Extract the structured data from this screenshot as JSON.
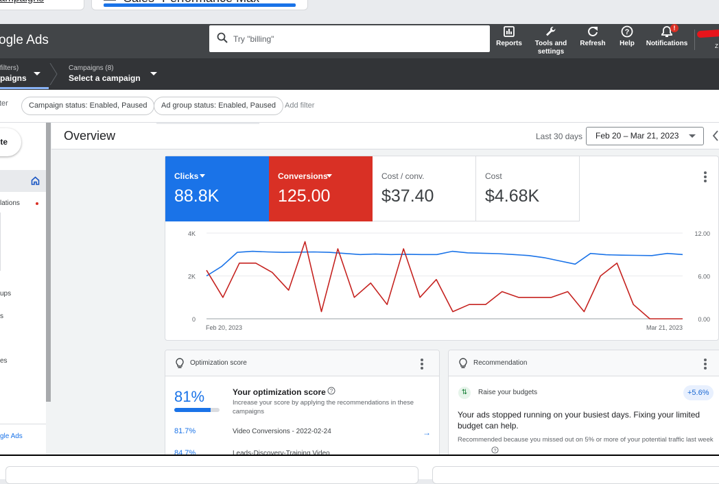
{
  "background_tabs": {
    "left_label": "ampaigns",
    "right_label": "Sales- Performance Max -"
  },
  "app": {
    "logo": "ogle Ads",
    "search_placeholder": "Try \"billing\"",
    "tools": [
      {
        "label": "Reports",
        "icon": "reports-icon"
      },
      {
        "label": "Tools and settings",
        "icon": "wrench-icon"
      },
      {
        "label": "Refresh",
        "icon": "refresh-icon"
      },
      {
        "label": "Help",
        "icon": "help-icon"
      },
      {
        "label": "Notifications",
        "icon": "bell-icon"
      }
    ],
    "notification_badge": "!",
    "avatar_initial": "Z"
  },
  "breadcrumb": {
    "first_small": "filters)",
    "first_big": "paigns",
    "second_small": "Campaigns (8)",
    "second_big": "Select a campaign"
  },
  "filters": {
    "prefix": "ter",
    "chips": [
      "Campaign status: Enabled, Paused",
      "Ad group status: Enabled, Paused"
    ],
    "add_filter": "Add filter"
  },
  "nav": {
    "create": "te",
    "items": [
      "lations",
      "ups",
      "s",
      "es"
    ],
    "footer": "gle Ads"
  },
  "overview": {
    "title": "Overview",
    "date_label": "Last 30 days",
    "date_range": "Feb 20 – Mar 21, 2023"
  },
  "metrics": [
    {
      "label": "Clicks",
      "value": "88.8K",
      "color": "#1a73e8"
    },
    {
      "label": "Conversions",
      "value": "125.00",
      "color": "#d93025"
    },
    {
      "label": "Cost / conv.",
      "value": "$37.40"
    },
    {
      "label": "Cost",
      "value": "$4.68K"
    }
  ],
  "chart_data": {
    "type": "line",
    "x_start_label": "Feb 20, 2023",
    "x_end_label": "Mar 21, 2023",
    "y_left_ticks": [
      "4K",
      "2K",
      "0"
    ],
    "y_right_ticks": [
      "12.00",
      "6.00",
      "0.00"
    ],
    "y_left_lim": [
      0,
      4000
    ],
    "y_right_lim": [
      0,
      12
    ],
    "series": [
      {
        "name": "Clicks",
        "axis": "left",
        "color": "#1a73e8",
        "values": [
          2000,
          2450,
          3100,
          3150,
          3120,
          3100,
          3110,
          3120,
          3100,
          3050,
          3000,
          3020,
          3000,
          3010,
          3000,
          3000,
          3150,
          3080,
          3060,
          3040,
          3000,
          2950,
          2850,
          2700,
          2550,
          3050,
          2990,
          2970,
          2960,
          2950,
          3050,
          3000
        ]
      },
      {
        "name": "Conversions",
        "axis": "right",
        "color": "#c5221f",
        "values": [
          6.8,
          3.0,
          7.8,
          7.8,
          6.5,
          4.0,
          10.8,
          1.0,
          9.8,
          3.0,
          5.0,
          2.0,
          9.8,
          3.0,
          5.5,
          1.0,
          2.0,
          2.0,
          3.8,
          3.0,
          3.0,
          3.0,
          3.8,
          1.0,
          6.0,
          7.8,
          2.0,
          0.0,
          0.0,
          0.0
        ]
      }
    ]
  },
  "optimization": {
    "title": "Optimization score",
    "score": "81%",
    "score_fraction": 0.81,
    "heading": "Your optimization score",
    "description": "Increase your score by applying the recommendations in these campaigns",
    "rows": [
      {
        "value": "81.7%",
        "name": "Video Conversions - 2022-02-24"
      },
      {
        "value": "84.7%",
        "name": "Leads-Discovery-Training Video"
      }
    ]
  },
  "recommendation": {
    "title": "Recommendation",
    "item": "Raise your budgets",
    "delta": "+5.6%",
    "body": "Your ads stopped running on your busiest days. Fixing your limited budget can help.",
    "note": "Recommended because you missed out on 5% or more of your potential traffic last week"
  }
}
